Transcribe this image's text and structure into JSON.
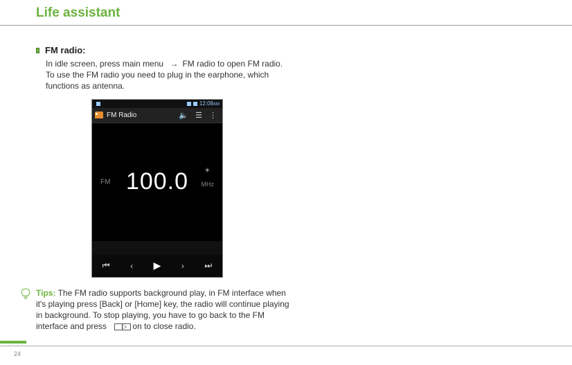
{
  "chapter_title": "Life assistant",
  "section": {
    "title": "FM radio:",
    "body_part1": "In idle screen, press main menu",
    "body_arrow": "→",
    "body_part2": "FM radio to open FM radio. To use the FM radio you need to plug in the earphone, which functions as antenna."
  },
  "phone": {
    "status_time": "12:09",
    "status_suffix": "AM",
    "app_title": "FM Radio",
    "speaker_icon": "🔈",
    "list_icon": "☰",
    "menu_icon": "⋮",
    "fm_label": "FM",
    "frequency": "100.0",
    "mhz_label": "MHz",
    "star": "✶",
    "prev_track": "⏮",
    "prev": "‹",
    "play": "▶",
    "next": "›",
    "next_track": "⏭"
  },
  "tips": {
    "label": "Tips:",
    "text_part1": " The FM radio supports background play, in FM interface when it's playing press [Back] or [Home] key, the radio will continue playing in background. To stop playing, you have to go back to the FM interface and press ",
    "text_part2": "on to close radio."
  },
  "page_number": "24",
  "colors": {
    "accent": "#6db33f"
  }
}
